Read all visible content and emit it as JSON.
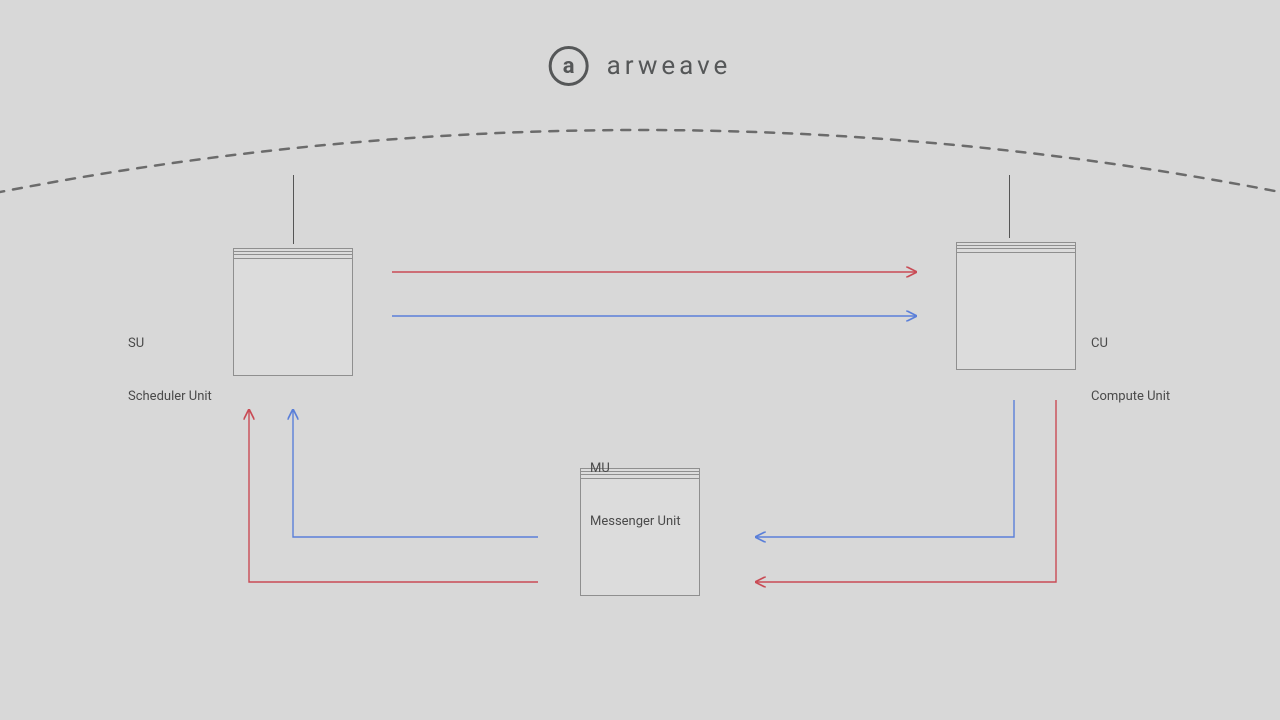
{
  "brand": {
    "mark_letter": "a",
    "wordmark": "arweave"
  },
  "nodes": {
    "su": {
      "code": "SU",
      "name": "Scheduler Unit"
    },
    "cu": {
      "code": "CU",
      "name": "Compute Unit"
    },
    "mu": {
      "code": "MU",
      "name": "Messenger Unit"
    }
  },
  "colors": {
    "red": "#c94b55",
    "blue": "#5a7fd9",
    "gray": "#6b6b6b",
    "box_stroke": "#8f8f8f"
  },
  "flows": [
    {
      "from": "SU",
      "to": "CU",
      "color": "red"
    },
    {
      "from": "SU",
      "to": "CU",
      "color": "blue"
    },
    {
      "from": "CU",
      "to": "MU",
      "color": "blue"
    },
    {
      "from": "CU",
      "to": "MU",
      "color": "red"
    },
    {
      "from": "MU",
      "to": "SU",
      "color": "blue"
    },
    {
      "from": "MU",
      "to": "SU",
      "color": "red"
    }
  ]
}
